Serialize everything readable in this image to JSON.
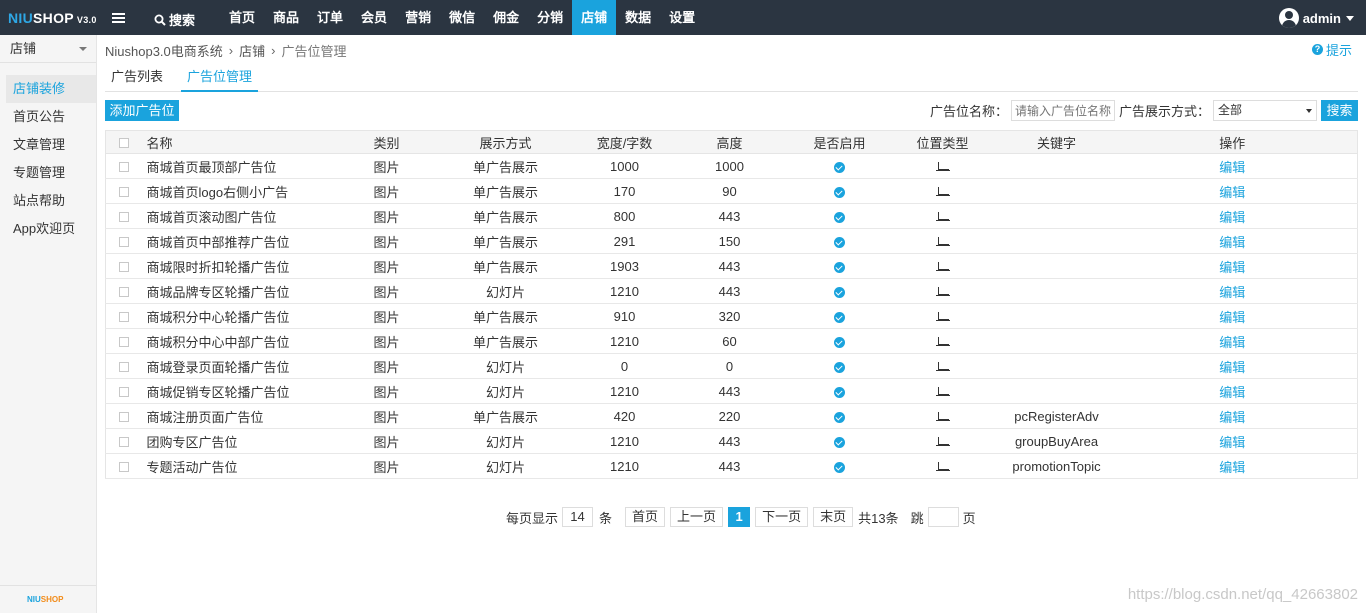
{
  "topbar": {
    "logo_ni": "NIU",
    "logo_rest": "SHOP",
    "logo_version": "V3.0",
    "search_label": "搜索",
    "nav": [
      "首页",
      "商品",
      "订单",
      "会员",
      "营销",
      "微信",
      "佣金",
      "分销",
      "店铺",
      "数据",
      "设置"
    ],
    "active_nav": "店铺",
    "user_name": "admin",
    "accent_color": "#1aa3dd"
  },
  "sidebar": {
    "header": "店铺",
    "items": [
      "店铺装修",
      "首页公告",
      "文章管理",
      "专题管理",
      "站点帮助",
      "App欢迎页"
    ],
    "active_item": "店铺装修",
    "footer_logo_a": "NIU",
    "footer_logo_b": "SHOP"
  },
  "breadcrumb": {
    "root": "Niushop3.0电商系统",
    "section": "店铺",
    "current": "广告位管理"
  },
  "hint_label": "提示",
  "tabs": [
    "广告列表",
    "广告位管理"
  ],
  "active_tab": "广告位管理",
  "toolbar": {
    "add_label": "添加广告位",
    "name_label": "广告位名称：",
    "name_placeholder": "请输入广告位名称",
    "mode_label": "广告展示方式：",
    "mode_value": "全部",
    "search_label": "搜索"
  },
  "table": {
    "headers": [
      "名称",
      "类别",
      "展示方式",
      "宽度/字数",
      "高度",
      "是否启用",
      "位置类型",
      "关键字",
      "操作"
    ],
    "edit_label": "编辑",
    "rows": [
      {
        "name": "商城首页最顶部广告位",
        "type": "图片",
        "mode": "单广告展示",
        "width": "1000",
        "height": "1000",
        "keyword": ""
      },
      {
        "name": "商城首页logo右侧小广告",
        "type": "图片",
        "mode": "单广告展示",
        "width": "170",
        "height": "90",
        "keyword": ""
      },
      {
        "name": "商城首页滚动图广告位",
        "type": "图片",
        "mode": "单广告展示",
        "width": "800",
        "height": "443",
        "keyword": ""
      },
      {
        "name": "商城首页中部推荐广告位",
        "type": "图片",
        "mode": "单广告展示",
        "width": "291",
        "height": "150",
        "keyword": ""
      },
      {
        "name": "商城限时折扣轮播广告位",
        "type": "图片",
        "mode": "单广告展示",
        "width": "1903",
        "height": "443",
        "keyword": ""
      },
      {
        "name": "商城品牌专区轮播广告位",
        "type": "图片",
        "mode": "幻灯片",
        "width": "1210",
        "height": "443",
        "keyword": ""
      },
      {
        "name": "商城积分中心轮播广告位",
        "type": "图片",
        "mode": "单广告展示",
        "width": "910",
        "height": "320",
        "keyword": ""
      },
      {
        "name": "商城积分中心中部广告位",
        "type": "图片",
        "mode": "单广告展示",
        "width": "1210",
        "height": "60",
        "keyword": ""
      },
      {
        "name": "商城登录页面轮播广告位",
        "type": "图片",
        "mode": "幻灯片",
        "width": "0",
        "height": "0",
        "keyword": ""
      },
      {
        "name": "商城促销专区轮播广告位",
        "type": "图片",
        "mode": "幻灯片",
        "width": "1210",
        "height": "443",
        "keyword": ""
      },
      {
        "name": "商城注册页面广告位",
        "type": "图片",
        "mode": "单广告展示",
        "width": "420",
        "height": "220",
        "keyword": "pcRegisterAdv"
      },
      {
        "name": "团购专区广告位",
        "type": "图片",
        "mode": "幻灯片",
        "width": "1210",
        "height": "443",
        "keyword": "groupBuyArea"
      },
      {
        "name": "专题活动广告位",
        "type": "图片",
        "mode": "幻灯片",
        "width": "1210",
        "height": "443",
        "keyword": "promotionTopic"
      }
    ]
  },
  "pager": {
    "per_page_label": "每页显示",
    "per_page_value": "14",
    "unit": "条",
    "first": "首页",
    "prev": "上一页",
    "current": "1",
    "next": "下一页",
    "last": "末页",
    "total": "共13条",
    "jump_label": "跳",
    "page_unit": "页"
  },
  "watermark": "https://blog.csdn.net/qq_42663802"
}
